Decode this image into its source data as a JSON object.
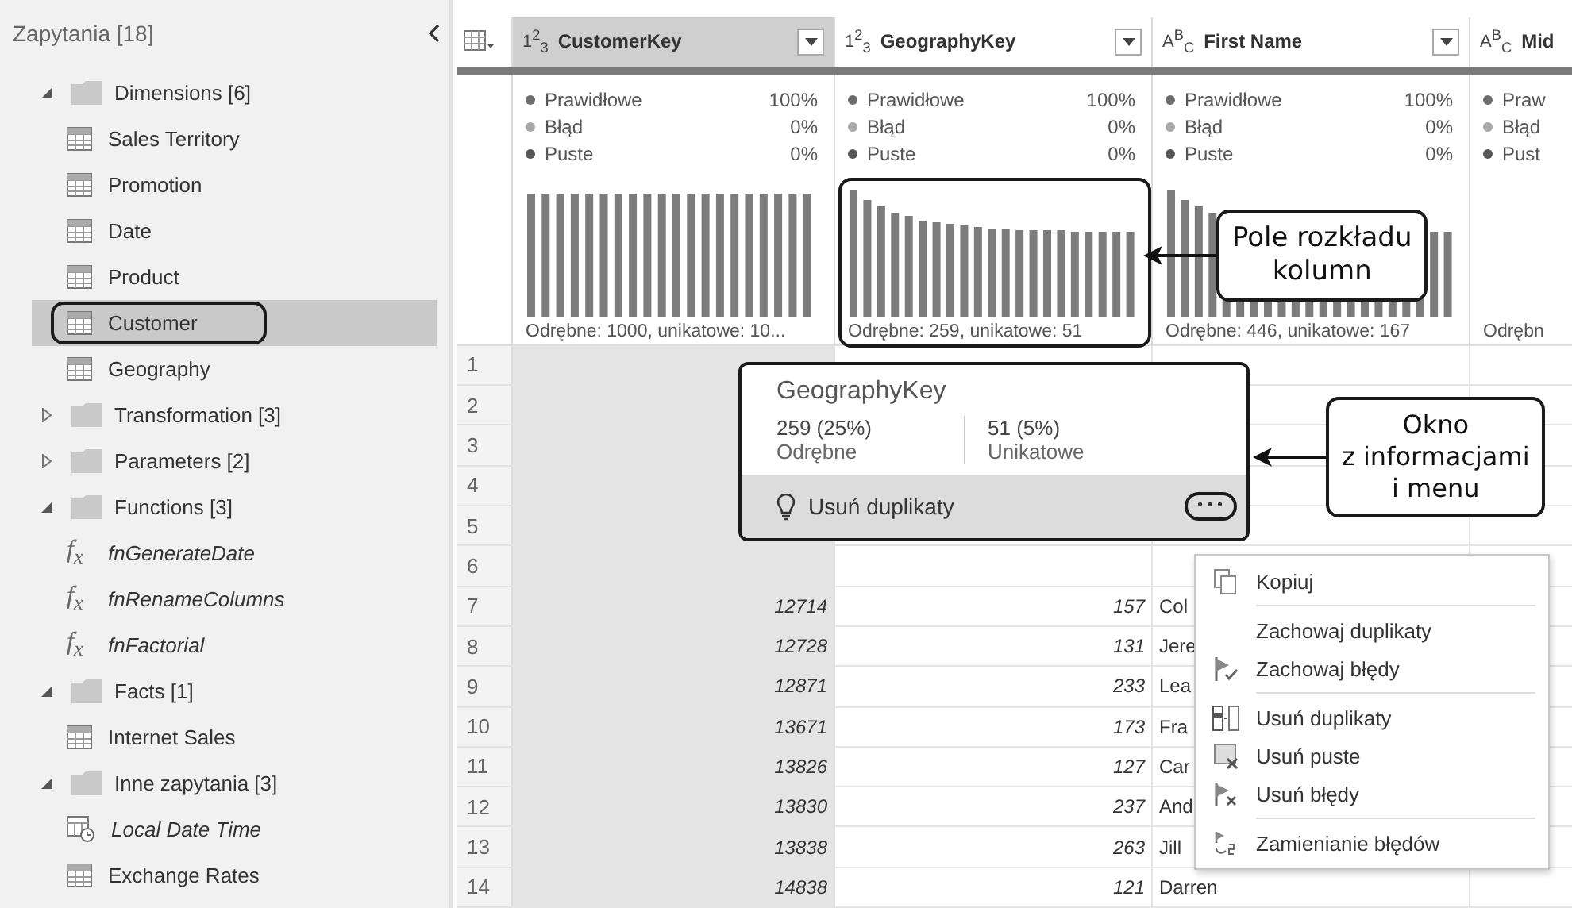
{
  "sidebar": {
    "title": "Zapytania [18]",
    "tree": [
      {
        "label": "Dimensions [6]",
        "kind": "folder",
        "expanded": true,
        "selected": false,
        "children": [
          {
            "label": "Sales Territory",
            "kind": "table",
            "selected": false,
            "highlighted": false
          },
          {
            "label": "Promotion",
            "kind": "table",
            "selected": false,
            "highlighted": false
          },
          {
            "label": "Date",
            "kind": "table",
            "selected": false,
            "highlighted": false
          },
          {
            "label": "Product",
            "kind": "table",
            "selected": false,
            "highlighted": false
          },
          {
            "label": "Customer",
            "kind": "table",
            "selected": true,
            "highlighted": true
          },
          {
            "label": "Geography",
            "kind": "table",
            "selected": false,
            "highlighted": false
          }
        ]
      },
      {
        "label": "Transformation [3]",
        "kind": "folder",
        "expanded": false,
        "selected": false
      },
      {
        "label": "Parameters [2]",
        "kind": "folder",
        "expanded": false,
        "selected": false
      },
      {
        "label": "Functions [3]",
        "kind": "folder",
        "expanded": true,
        "selected": false,
        "children": [
          {
            "label": "fnGenerateDate",
            "kind": "function",
            "symbol": "f$_{x}$",
            "selected": false,
            "highlighted": false
          },
          {
            "label": "fnRenameColumns",
            "kind": "function",
            "symbol": "f$_{x}$",
            "selected": false,
            "highlighted": false
          },
          {
            "label": "fnFactorial",
            "kind": "function",
            "symbol": "f$_{x}$",
            "selected": false,
            "highlighted": false
          }
        ]
      },
      {
        "label": "Facts [1]",
        "kind": "folder",
        "expanded": true,
        "selected": false,
        "children": [
          {
            "label": "Internet Sales",
            "kind": "table",
            "selected": false,
            "highlighted": false
          }
        ]
      },
      {
        "label": "Inne zapytania [3]",
        "kind": "folder",
        "expanded": true,
        "selected": false,
        "children": [
          {
            "label": "Local Date Time",
            "kind": "datetime",
            "selected": false,
            "highlighted": false
          },
          {
            "label": "Exchange Rates",
            "kind": "table",
            "selected": false,
            "highlighted": false
          }
        ]
      }
    ]
  },
  "grid": {
    "columns": [
      {
        "type_label": "1$^{2}$$_{3}$",
        "name": "CustomerKey",
        "selected": true,
        "dropdown": true,
        "highlighted": false,
        "summary": "Odrębne: 1000, unikatowe: 10...",
        "stats": [
          {
            "label": "Prawidłowe",
            "value": "100%",
            "color": "#6e6e6e"
          },
          {
            "label": "Błąd",
            "value": "0%",
            "color": "#a8a8a8"
          },
          {
            "label": "Puste",
            "value": "0%",
            "color": "#555555"
          }
        ]
      },
      {
        "type_label": "1$^{2}$$_{3}$",
        "name": "GeographyKey",
        "selected": false,
        "dropdown": true,
        "highlighted": true,
        "summary": "Odrębne: 259, unikatowe: 51",
        "stats": [
          {
            "label": "Prawidłowe",
            "value": "100%",
            "color": "#6e6e6e"
          },
          {
            "label": "Błąd",
            "value": "0%",
            "color": "#a8a8a8"
          },
          {
            "label": "Puste",
            "value": "0%",
            "color": "#555555"
          }
        ]
      },
      {
        "type_label": "A$^{B}$$_{C}$",
        "name": "First Name",
        "selected": false,
        "dropdown": true,
        "highlighted": false,
        "summary": "Odrębne: 446, unikatowe: 167",
        "stats": [
          {
            "label": "Prawidłowe",
            "value": "100%",
            "color": "#6e6e6e"
          },
          {
            "label": "Błąd",
            "value": "0%",
            "color": "#a8a8a8"
          },
          {
            "label": "Puste",
            "value": "0%",
            "color": "#555555"
          }
        ]
      },
      {
        "type_label": "A$^{B}$$_{C}$",
        "name": "Mid",
        "selected": false,
        "highlighted": false,
        "summary": "Odrębn",
        "stats": [
          {
            "label": "Praw",
            "color": "#6e6e6e"
          },
          {
            "label": "Błąd",
            "color": "#a8a8a8"
          },
          {
            "label": "Pust",
            "color": "#555555"
          }
        ]
      }
    ],
    "rows": [
      {
        "index": "1"
      },
      {
        "index": "2"
      },
      {
        "index": "3"
      },
      {
        "index": "4"
      },
      {
        "index": "5"
      },
      {
        "index": "6"
      },
      {
        "index": "7",
        "cells": [
          "12714",
          "157",
          "Col"
        ]
      },
      {
        "index": "8",
        "cells": [
          "12728",
          "131",
          "Jere"
        ]
      },
      {
        "index": "9",
        "cells": [
          "12871",
          "233",
          "Lea"
        ]
      },
      {
        "index": "10",
        "cells": [
          "13671",
          "173",
          "Fra"
        ]
      },
      {
        "index": "11",
        "cells": [
          "13826",
          "127",
          "Car"
        ]
      },
      {
        "index": "12",
        "cells": [
          "13830",
          "237",
          "And"
        ]
      },
      {
        "index": "13",
        "cells": [
          "13838",
          "263",
          "Jill"
        ]
      },
      {
        "index": "14",
        "cells": [
          "14838",
          "121",
          "Darren"
        ]
      }
    ]
  },
  "popup": {
    "title": "GeographyKey",
    "stats": [
      {
        "value": "259 (25%)",
        "label": "Odrębne"
      },
      {
        "value": "51 (5%)",
        "label": "Unikatowe"
      }
    ],
    "action": "Usuń duplikaty",
    "more_label": "•••",
    "more_highlighted": true
  },
  "context_menu": [
    {
      "kind": "item",
      "label": "Kopiuj"
    },
    {
      "kind": "separator"
    },
    {
      "kind": "item",
      "label": "Zachowaj duplikaty"
    },
    {
      "kind": "item",
      "label": "Zachowaj błędy"
    },
    {
      "kind": "separator"
    },
    {
      "kind": "item",
      "label": "Usuń duplikaty"
    },
    {
      "kind": "item",
      "label": "Usuń puste"
    },
    {
      "kind": "item",
      "label": "Usuń błędy"
    },
    {
      "kind": "separator"
    },
    {
      "kind": "item",
      "label": "Zamienianie błędów"
    }
  ],
  "callouts": [
    {
      "text": "Pole rozkładu\nkolumn"
    },
    {
      "text": "Okno\nz informacjami\ni menu"
    }
  ]
}
